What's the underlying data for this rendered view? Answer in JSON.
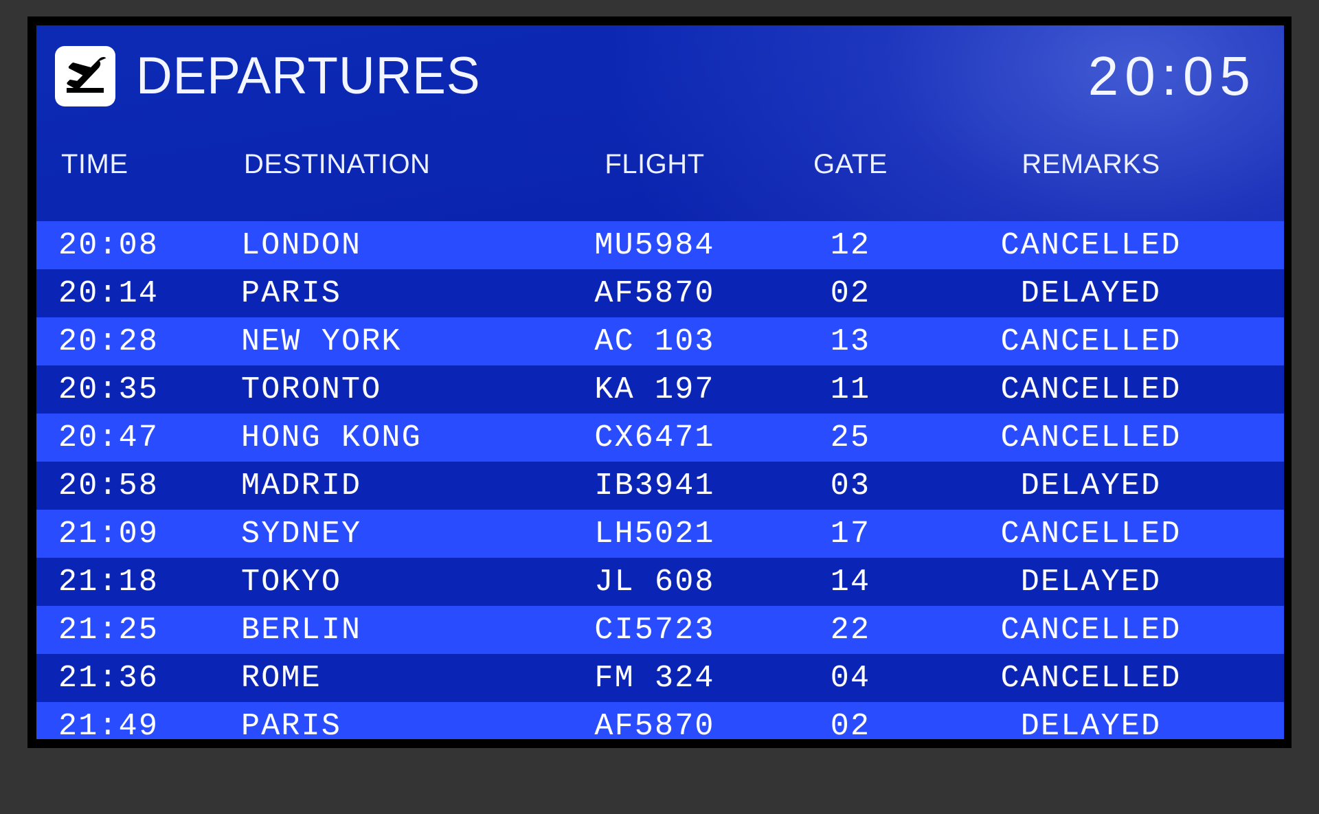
{
  "board": {
    "title": "DEPARTURES",
    "icon": "departing-plane-icon",
    "clock": "20:05",
    "accent_bg": "#0a22ad",
    "row_light": "#2a4cff",
    "row_dark": "#0a24b6",
    "text_color": "#ffffff"
  },
  "columns": {
    "time": "TIME",
    "destination": "DESTINATION",
    "flight": "FLIGHT",
    "gate": "GATE",
    "remarks": "REMARKS"
  },
  "flights": [
    {
      "time": "20:08",
      "destination": "LONDON",
      "flight": "MU5984",
      "gate": "12",
      "remarks": "CANCELLED"
    },
    {
      "time": "20:14",
      "destination": "PARIS",
      "flight": "AF5870",
      "gate": "02",
      "remarks": "DELAYED"
    },
    {
      "time": "20:28",
      "destination": "NEW YORK",
      "flight": "AC 103",
      "gate": "13",
      "remarks": "CANCELLED"
    },
    {
      "time": "20:35",
      "destination": "TORONTO",
      "flight": "KA 197",
      "gate": "11",
      "remarks": "CANCELLED"
    },
    {
      "time": "20:47",
      "destination": "HONG KONG",
      "flight": "CX6471",
      "gate": "25",
      "remarks": "CANCELLED"
    },
    {
      "time": "20:58",
      "destination": "MADRID",
      "flight": "IB3941",
      "gate": "03",
      "remarks": "DELAYED"
    },
    {
      "time": "21:09",
      "destination": "SYDNEY",
      "flight": "LH5021",
      "gate": "17",
      "remarks": "CANCELLED"
    },
    {
      "time": "21:18",
      "destination": "TOKYO",
      "flight": "JL 608",
      "gate": "14",
      "remarks": "DELAYED"
    },
    {
      "time": "21:25",
      "destination": "BERLIN",
      "flight": "CI5723",
      "gate": "22",
      "remarks": "CANCELLED"
    },
    {
      "time": "21:36",
      "destination": "ROME",
      "flight": "FM 324",
      "gate": "04",
      "remarks": "CANCELLED"
    },
    {
      "time": "21:49",
      "destination": "PARIS",
      "flight": "AF5870",
      "gate": "02",
      "remarks": "DELAYED"
    }
  ]
}
